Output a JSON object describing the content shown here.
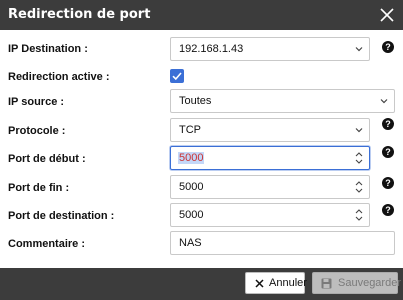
{
  "dialog": {
    "title": "Redirection de port",
    "close_icon": "close-icon"
  },
  "form": {
    "ip_destination": {
      "label": "IP Destination :",
      "value": "192.168.1.43"
    },
    "redirection_active": {
      "label": "Redirection active :",
      "checked": true
    },
    "ip_source": {
      "label": "IP source :",
      "value": "Toutes"
    },
    "protocole": {
      "label": "Protocole :",
      "value": "TCP"
    },
    "port_debut": {
      "label": "Port de début :",
      "value": "5000"
    },
    "port_fin": {
      "label": "Port de fin :",
      "value": "5000"
    },
    "port_destination": {
      "label": "Port de destination :",
      "value": "5000"
    },
    "commentaire": {
      "label": "Commentaire :",
      "value": "NAS"
    }
  },
  "help_glyph": "?",
  "footer": {
    "cancel_label": "Annuler",
    "save_label": "Sauvegarder"
  },
  "colors": {
    "titlebar": "#3c3c3c",
    "accent": "#3b6fd6",
    "save_disabled": "#bdbdbd"
  }
}
